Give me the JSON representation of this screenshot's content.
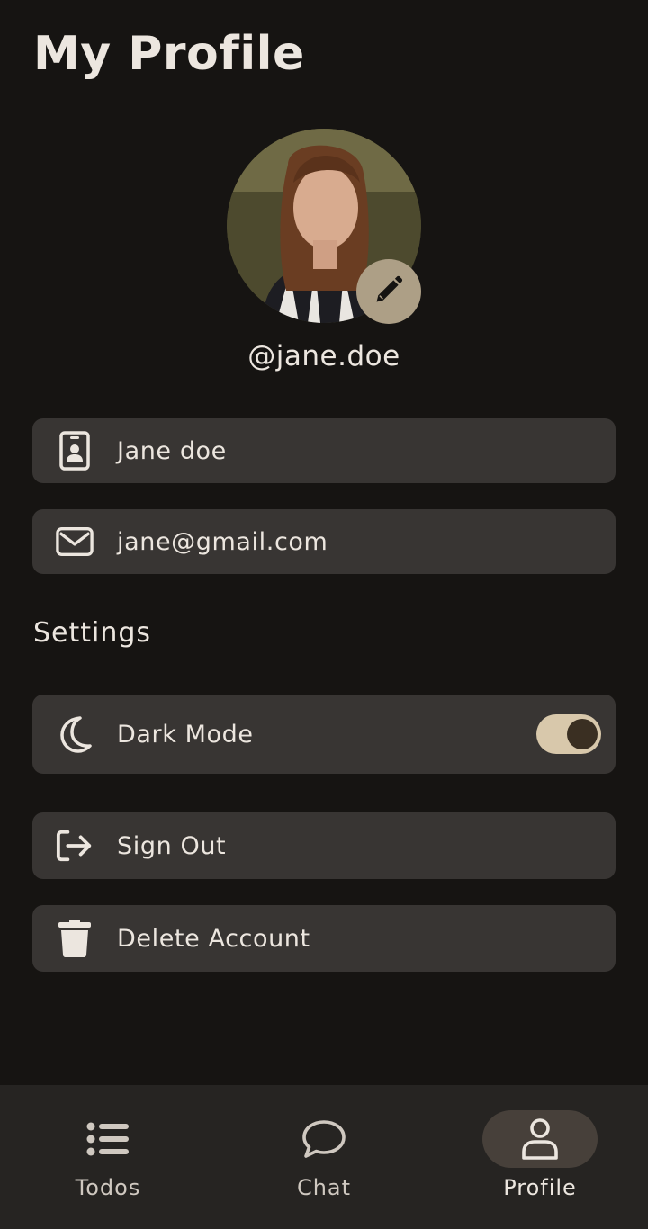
{
  "header": {
    "title": "My Profile"
  },
  "profile": {
    "username": "@jane.doe",
    "avatar_icon": "user-photo",
    "edit_icon": "pencil-icon"
  },
  "fields": {
    "name": {
      "value": "Jane doe",
      "icon": "id-badge-icon"
    },
    "email": {
      "value": "jane@gmail.com",
      "icon": "envelope-icon"
    }
  },
  "settings": {
    "title": "Settings",
    "dark_mode": {
      "label": "Dark Mode",
      "icon": "moon-icon",
      "enabled": true
    },
    "sign_out": {
      "label": "Sign Out",
      "icon": "sign-out-icon"
    },
    "delete_account": {
      "label": "Delete Account",
      "icon": "trash-icon"
    }
  },
  "nav": {
    "items": [
      {
        "label": "Todos",
        "icon": "list-icon",
        "active": false
      },
      {
        "label": "Chat",
        "icon": "chat-bubble-icon",
        "active": false
      },
      {
        "label": "Profile",
        "icon": "person-icon",
        "active": true
      }
    ]
  },
  "colors": {
    "background": "#161412",
    "card": "#383533",
    "accent": "#d8c8ab",
    "edit_button": "#ad9f86",
    "nav_bar": "#262422"
  }
}
